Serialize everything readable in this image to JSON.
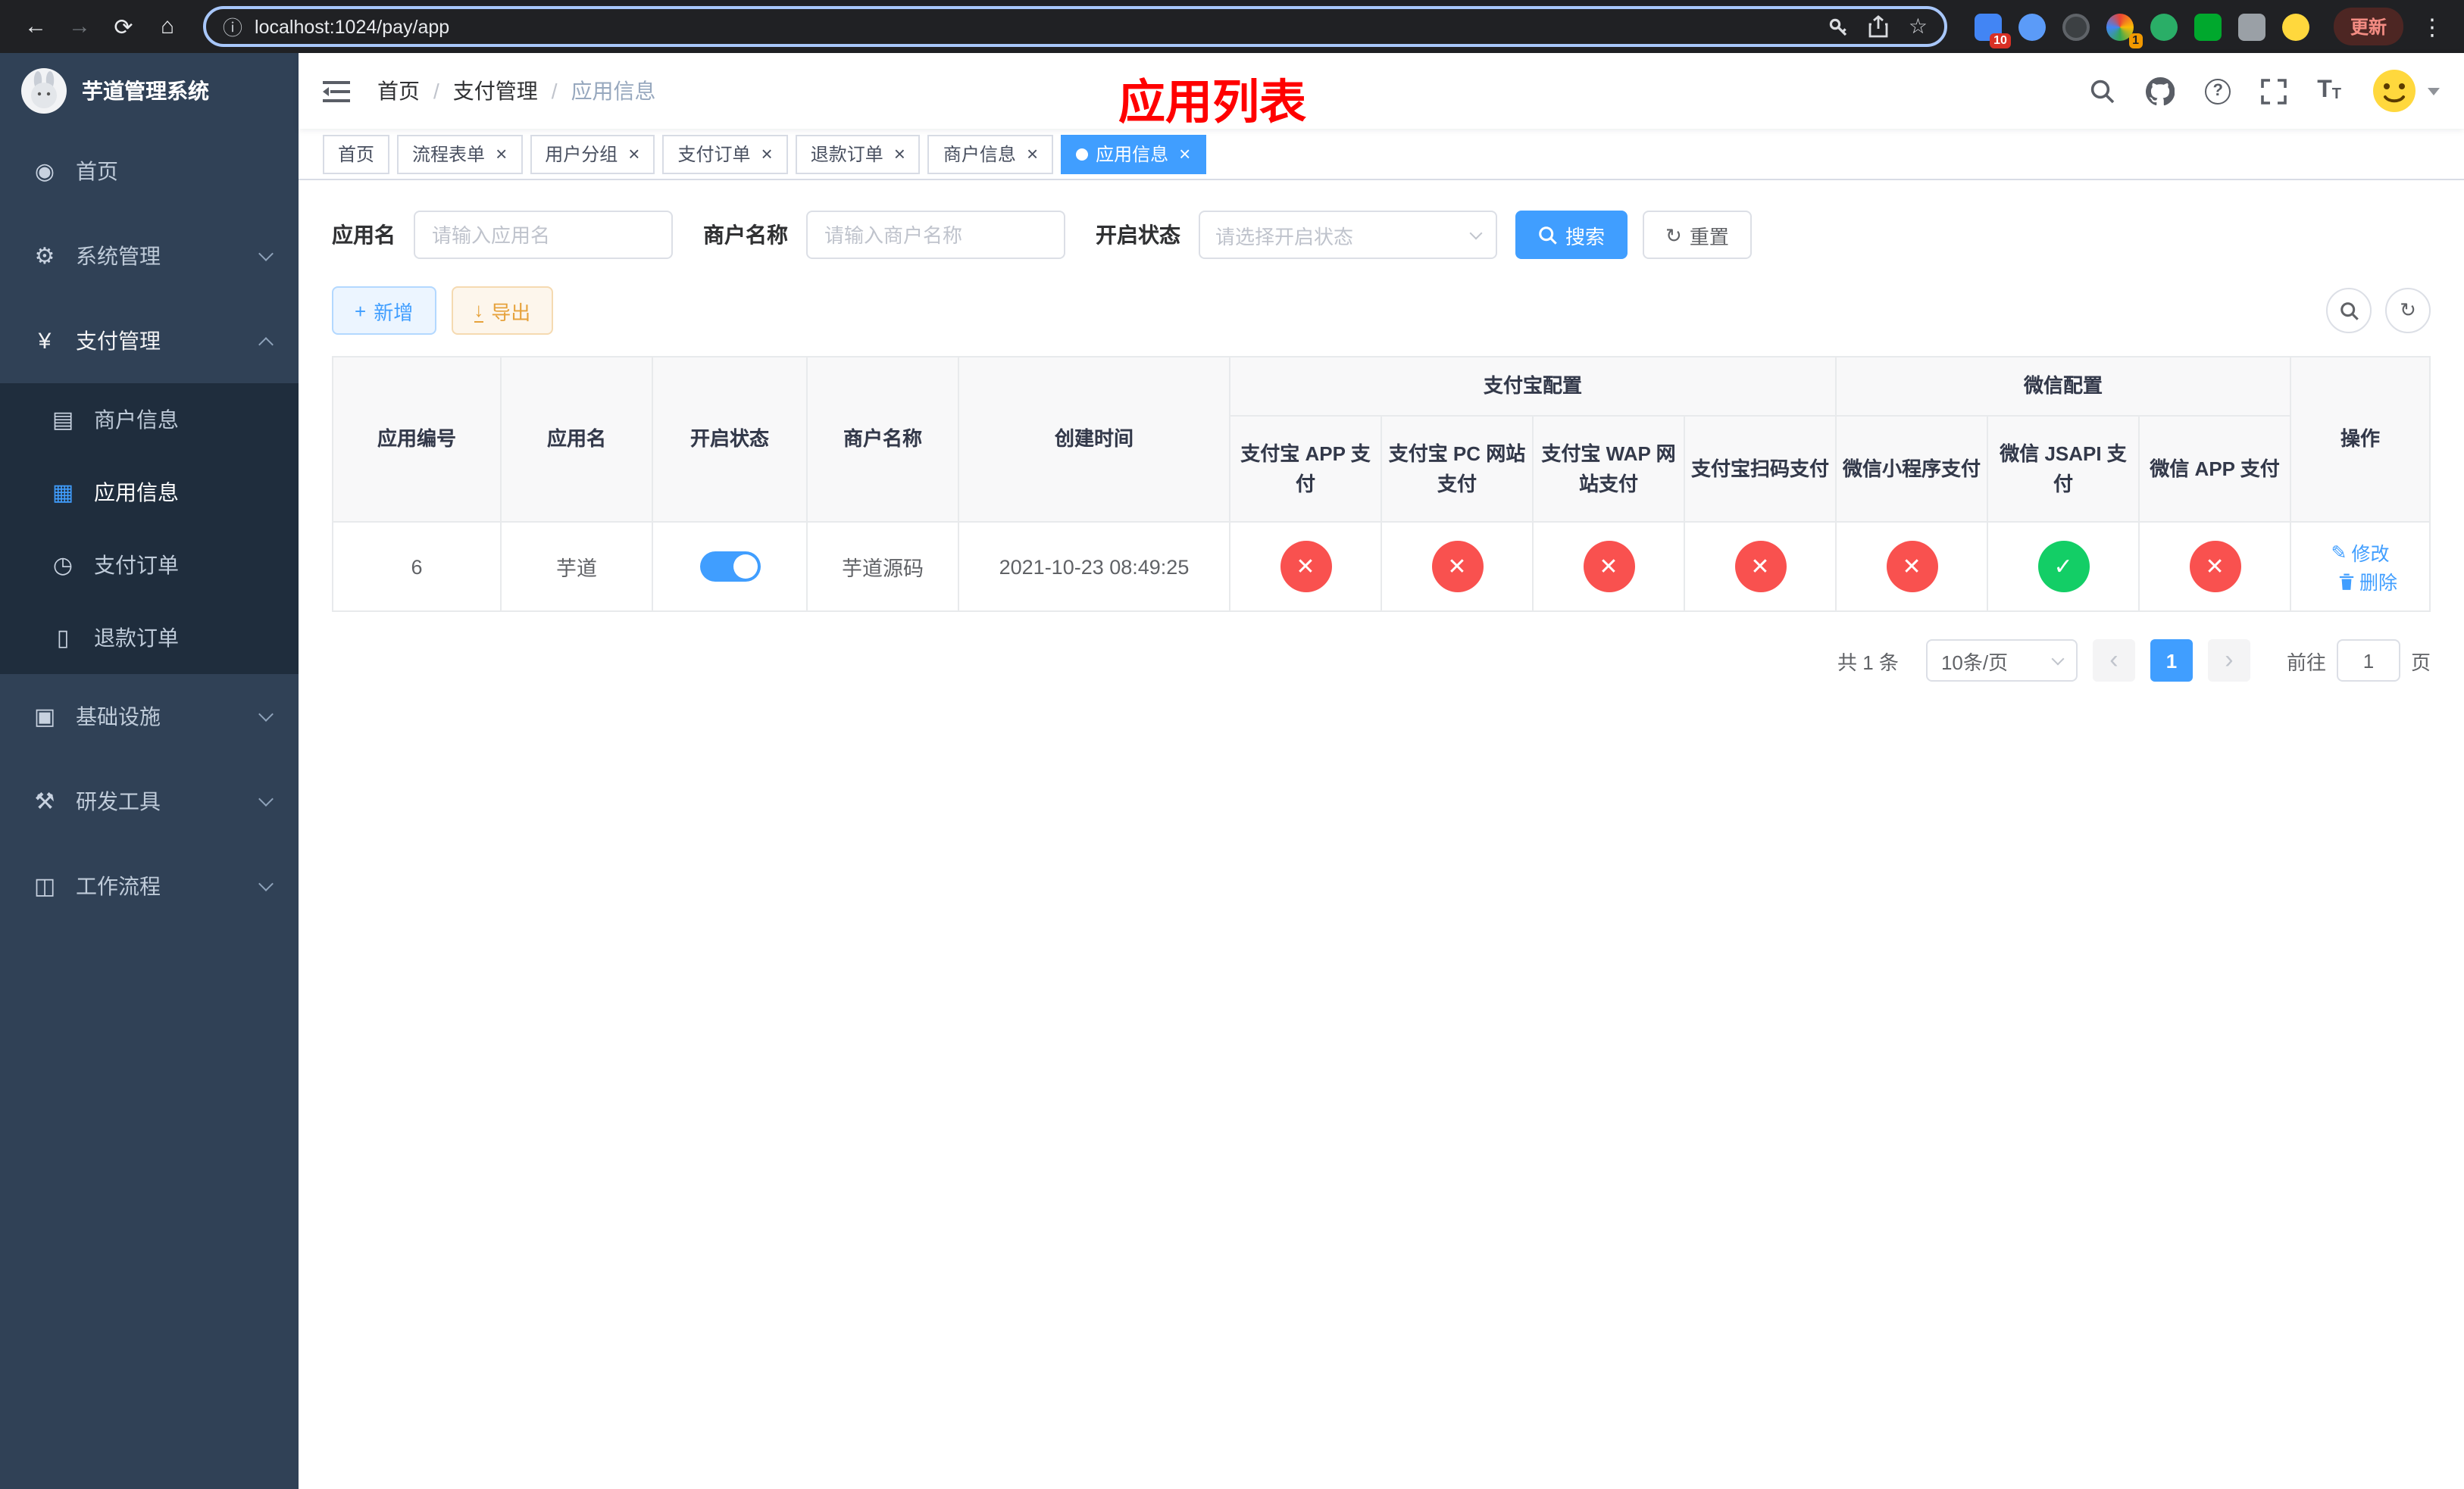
{
  "browser": {
    "url": "localhost:1024/pay/app",
    "update_label": "更新",
    "ext_badge_1": "10",
    "ext_badge_2": "1"
  },
  "icons": {
    "back": "←",
    "forward": "→",
    "reload": "⟳",
    "home": "⌂",
    "info": "ⓘ",
    "star": "☆",
    "dots": "⋮",
    "question": "?",
    "font_t": "T",
    "close": "×",
    "plus": "+",
    "download": "↓",
    "refresh": "↻",
    "edit": "✎",
    "prev": "‹",
    "next": "›",
    "dashboard": "◉",
    "gear": "⚙",
    "yen": "¥",
    "merchant": "▤",
    "app": "▦",
    "pay_order": "◷",
    "refund_order": "▯",
    "infra": "▣",
    "devtools": "⚒",
    "workflow": "◫"
  },
  "sidebar": {
    "title": "芋道管理系统",
    "items": {
      "home": "首页",
      "system": "系统管理",
      "payment": "支付管理",
      "merchant_info": "商户信息",
      "app_info": "应用信息",
      "pay_order": "支付订单",
      "refund_order": "退款订单",
      "infrastructure": "基础设施",
      "devtools": "研发工具",
      "workflow": "工作流程"
    }
  },
  "header": {
    "breadcrumb_1": "首页",
    "breadcrumb_2": "支付管理",
    "breadcrumb_3": "应用信息",
    "annotation": "应用列表"
  },
  "tabs": [
    {
      "label": "首页"
    },
    {
      "label": "流程表单"
    },
    {
      "label": "用户分组"
    },
    {
      "label": "支付订单"
    },
    {
      "label": "退款订单"
    },
    {
      "label": "商户信息"
    },
    {
      "label": "应用信息"
    }
  ],
  "filters": {
    "app_name_label": "应用名",
    "app_name_placeholder": "请输入应用名",
    "merchant_label": "商户名称",
    "merchant_placeholder": "请输入商户名称",
    "status_label": "开启状态",
    "status_placeholder": "请选择开启状态",
    "search_label": "搜索",
    "reset_label": "重置"
  },
  "toolbar": {
    "add_label": "新增",
    "export_label": "导出"
  },
  "table": {
    "header": {
      "app_id": "应用编号",
      "app_name": "应用名",
      "status": "开启状态",
      "merchant_name": "商户名称",
      "created_at": "创建时间",
      "alipay_group": "支付宝配置",
      "wechat_group": "微信配置",
      "alipay_app": "支付宝 APP 支付",
      "alipay_pc": "支付宝 PC 网站支付",
      "alipay_wap": "支付宝 WAP 网站支付",
      "alipay_qr": "支付宝扫码支付",
      "wx_lite": "微信小程序支付",
      "wx_jsapi": "微信 JSAPI 支付",
      "wx_app": "微信 APP 支付",
      "actions": "操作"
    },
    "rows": [
      {
        "app_id": "6",
        "app_name": "芋道",
        "status": "on",
        "merchant_name": "芋道源码",
        "created_at": "2021-10-23 08:49:25",
        "configs": {
          "alipay_app": "off",
          "alipay_pc": "off",
          "alipay_wap": "off",
          "alipay_qr": "off",
          "wx_lite": "off",
          "wx_jsapi": "on",
          "wx_app": "off"
        },
        "edit_label": "修改",
        "delete_label": "删除"
      }
    ]
  },
  "pagination": {
    "total": "共 1 条",
    "page_size": "10条/页",
    "page": "1",
    "jump_prefix": "前往",
    "jump_suffix": "页",
    "jump_value": "1"
  },
  "colors": {
    "accent": "#409eff",
    "danger": "#f9514f",
    "success": "#13ce66",
    "annotation_red": "#ff0000",
    "sidebar_bg": "#304156",
    "submenu_bg": "#1f2d3d"
  }
}
